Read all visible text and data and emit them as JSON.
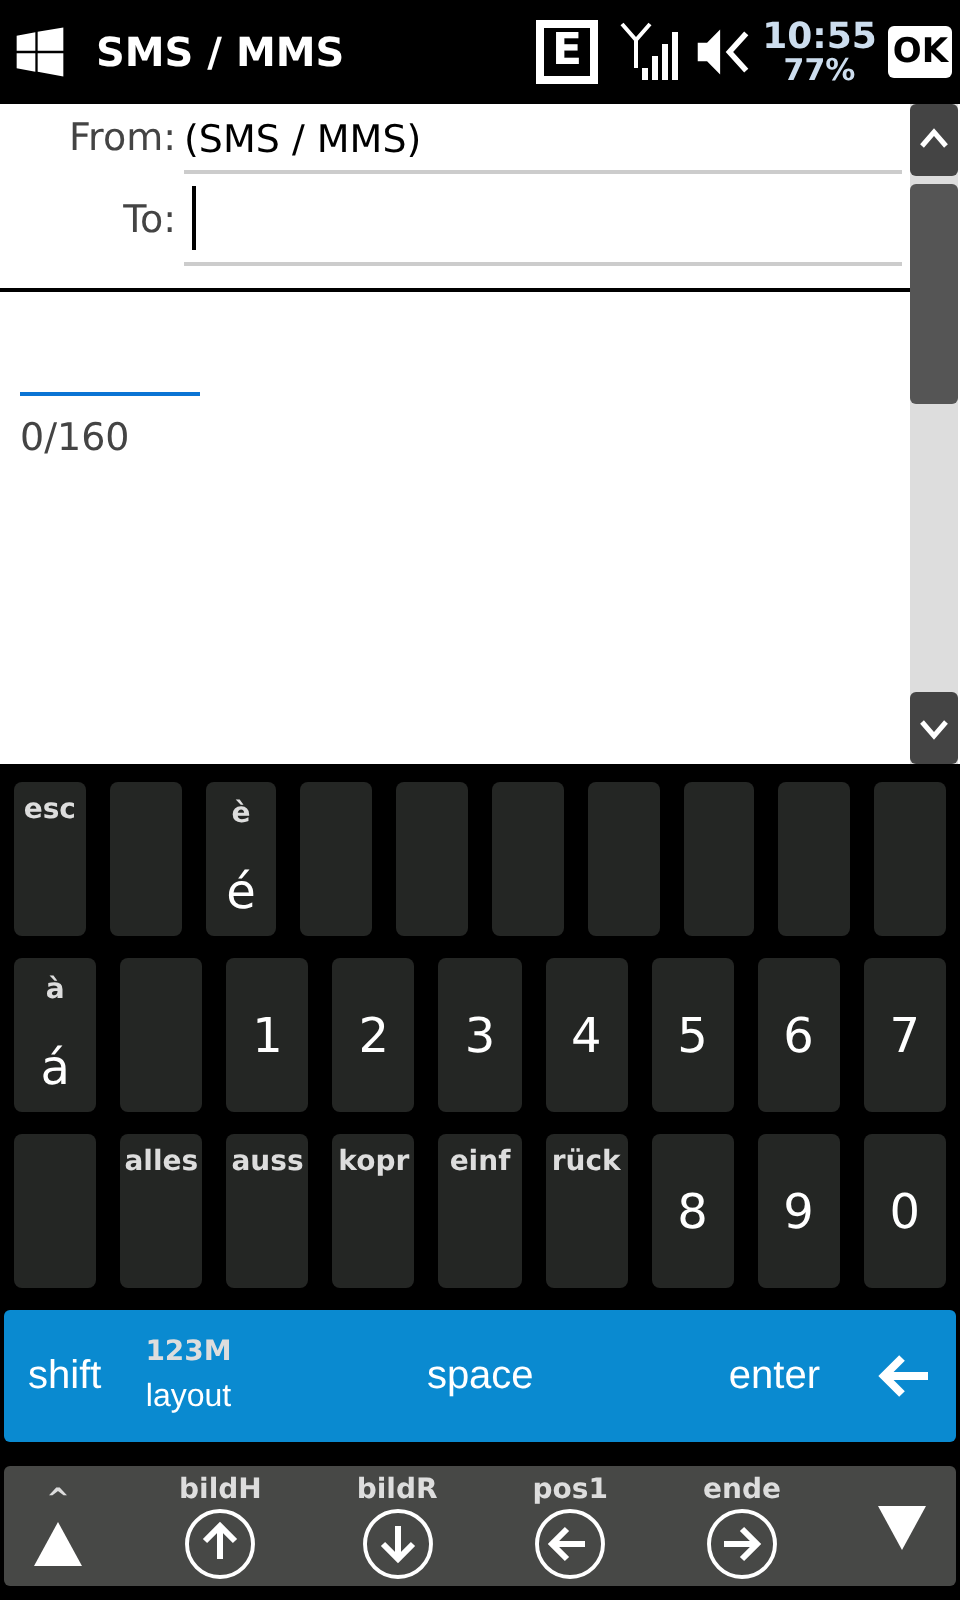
{
  "status_bar": {
    "title": "SMS / MMS",
    "network": "E",
    "time": "10:55",
    "battery": "77%",
    "ok": "OK"
  },
  "message": {
    "from_label": "From:",
    "from_value": "(SMS / MMS)",
    "to_label": "To:",
    "counter": "0/160"
  },
  "keyboard": {
    "rows": [
      [
        {
          "kind": "label",
          "top": "esc"
        },
        {
          "kind": "blank"
        },
        {
          "kind": "char",
          "top": "è",
          "main": "é"
        },
        {
          "kind": "blank"
        },
        {
          "kind": "blank"
        },
        {
          "kind": "blank"
        },
        {
          "kind": "blank"
        },
        {
          "kind": "blank"
        },
        {
          "kind": "blank"
        },
        {
          "kind": "blank"
        }
      ],
      [
        {
          "kind": "char",
          "top": "à",
          "main": "á"
        },
        {
          "kind": "blank"
        },
        {
          "kind": "digit",
          "main": "1"
        },
        {
          "kind": "digit",
          "main": "2"
        },
        {
          "kind": "digit",
          "main": "3"
        },
        {
          "kind": "digit",
          "main": "4"
        },
        {
          "kind": "digit",
          "main": "5"
        },
        {
          "kind": "digit",
          "main": "6"
        },
        {
          "kind": "digit",
          "main": "7"
        }
      ],
      [
        {
          "kind": "blank"
        },
        {
          "kind": "label",
          "top": "alles"
        },
        {
          "kind": "label",
          "top": "auss"
        },
        {
          "kind": "label",
          "top": "kopr"
        },
        {
          "kind": "label",
          "top": "einf"
        },
        {
          "kind": "label",
          "top": "rück"
        },
        {
          "kind": "digit",
          "main": "8"
        },
        {
          "kind": "digit",
          "main": "9"
        },
        {
          "kind": "digit",
          "main": "0"
        }
      ]
    ],
    "action_bar": {
      "shift": "shift",
      "layout_top": "123M",
      "layout": "layout",
      "space": "space",
      "enter": "enter"
    },
    "nav_bar": [
      {
        "kind": "triangle-up",
        "label": "^"
      },
      {
        "kind": "circle-up",
        "label": "bildH"
      },
      {
        "kind": "circle-down",
        "label": "bildR"
      },
      {
        "kind": "circle-left",
        "label": "pos1"
      },
      {
        "kind": "circle-right",
        "label": "ende"
      },
      {
        "kind": "triangle-down"
      }
    ]
  }
}
